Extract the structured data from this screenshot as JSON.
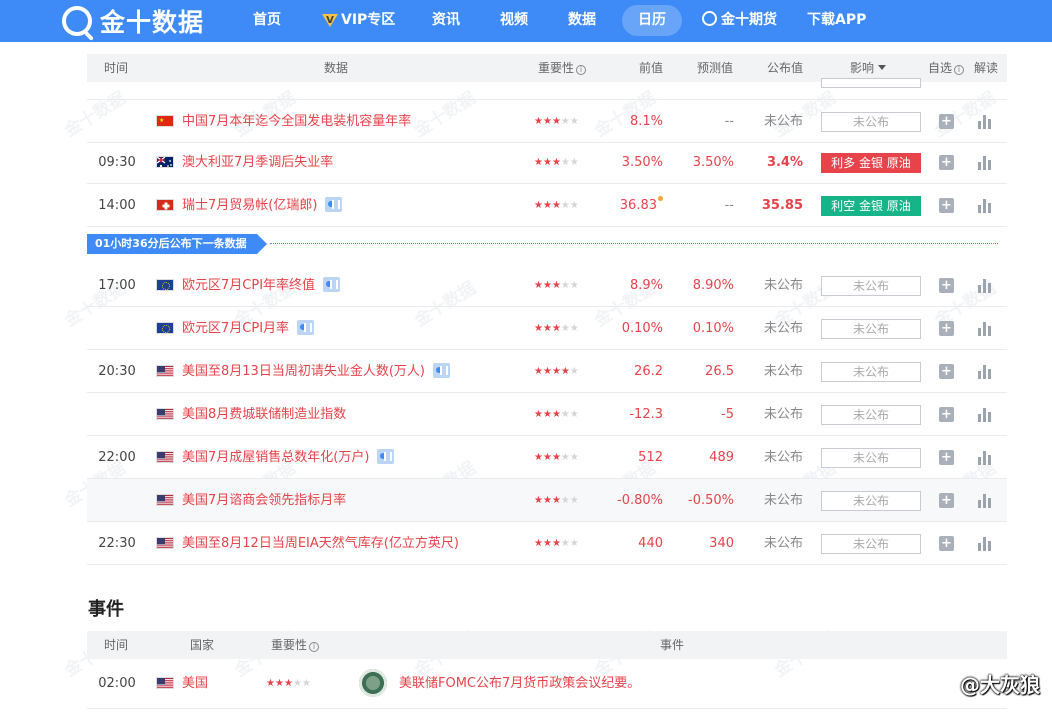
{
  "nav": {
    "logo": "金十数据",
    "items": [
      "首页",
      "VIP专区",
      "资讯",
      "视频",
      "数据",
      "日历",
      "金十期货",
      "下载APP"
    ],
    "active": "日历",
    "vip_badge": "V"
  },
  "table": {
    "headers": {
      "time": "时间",
      "data": "数据",
      "importance": "重要性",
      "prev": "前值",
      "forecast": "预测值",
      "actual": "公布值",
      "impact": "影响",
      "watch": "自选",
      "interpret": "解读"
    },
    "rows": [
      {
        "time": "",
        "flag": "china",
        "name": "中国7月本年迄今全国发电装机容量年率",
        "doc": false,
        "stars": 3,
        "prev": "8.1%",
        "forecast": "--",
        "actual": "未公布",
        "impact": "未公布",
        "impact_type": "none"
      },
      {
        "time": "09:30",
        "flag": "australia",
        "name": "澳大利亚7月季调后失业率",
        "doc": false,
        "stars": 3,
        "prev": "3.50%",
        "forecast": "3.50%",
        "actual": "3.4%",
        "impact": "利多 金银 原油",
        "impact_type": "bull"
      },
      {
        "time": "14:00",
        "flag": "switzerland",
        "name": "瑞士7月贸易帐(亿瑞郎)",
        "doc": true,
        "stars": 3,
        "prev": "36.83",
        "forecast": "--",
        "actual": "35.85",
        "impact": "利空 金银 原油",
        "impact_type": "bear"
      },
      {
        "time": "17:00",
        "flag": "eu",
        "name": "欧元区7月CPI年率终值",
        "doc": true,
        "stars": 3,
        "prev": "8.9%",
        "forecast": "8.90%",
        "actual": "未公布",
        "impact": "未公布",
        "impact_type": "none"
      },
      {
        "time": "",
        "flag": "eu",
        "name": "欧元区7月CPI月率",
        "doc": true,
        "stars": 3,
        "prev": "0.10%",
        "forecast": "0.10%",
        "actual": "未公布",
        "impact": "未公布",
        "impact_type": "none"
      },
      {
        "time": "20:30",
        "flag": "usa",
        "name": "美国至8月13日当周初请失业金人数(万人)",
        "doc": true,
        "stars": 4,
        "prev": "26.2",
        "forecast": "26.5",
        "actual": "未公布",
        "impact": "未公布",
        "impact_type": "none"
      },
      {
        "time": "",
        "flag": "usa",
        "name": "美国8月费城联储制造业指数",
        "doc": false,
        "stars": 3,
        "prev": "-12.3",
        "forecast": "-5",
        "actual": "未公布",
        "impact": "未公布",
        "impact_type": "none"
      },
      {
        "time": "22:00",
        "flag": "usa",
        "name": "美国7月成屋销售总数年化(万户)",
        "doc": true,
        "stars": 3,
        "prev": "512",
        "forecast": "489",
        "actual": "未公布",
        "impact": "未公布",
        "impact_type": "none"
      },
      {
        "time": "",
        "flag": "usa",
        "name": "美国7月谘商会领先指标月率",
        "doc": false,
        "stars": 3,
        "prev": "-0.80%",
        "forecast": "-0.50%",
        "actual": "未公布",
        "impact": "未公布",
        "impact_type": "none"
      },
      {
        "time": "22:30",
        "flag": "usa",
        "name": "美国至8月12日当周EIA天然气库存(亿立方英尺)",
        "doc": false,
        "stars": 3,
        "prev": "440",
        "forecast": "340",
        "actual": "未公布",
        "impact": "未公布",
        "impact_type": "none"
      }
    ],
    "countdown": "01小时36分后公布下一条数据",
    "add_symbol": "+"
  },
  "events": {
    "title": "事件",
    "headers": {
      "time": "时间",
      "country": "国家",
      "importance": "重要性",
      "event": "事件"
    },
    "rows": [
      {
        "time": "02:00",
        "flag": "usa",
        "country": "美国",
        "stars": 3,
        "event": "美联储FOMC公布7月货币政策会议纪要。"
      }
    ]
  },
  "watermark": "金十数据",
  "signature": "@大灰狼",
  "colors": {
    "brand": "#3e8bf7",
    "red": "#e8434a",
    "green": "#16b489",
    "star_off": "#d6d6d6"
  }
}
